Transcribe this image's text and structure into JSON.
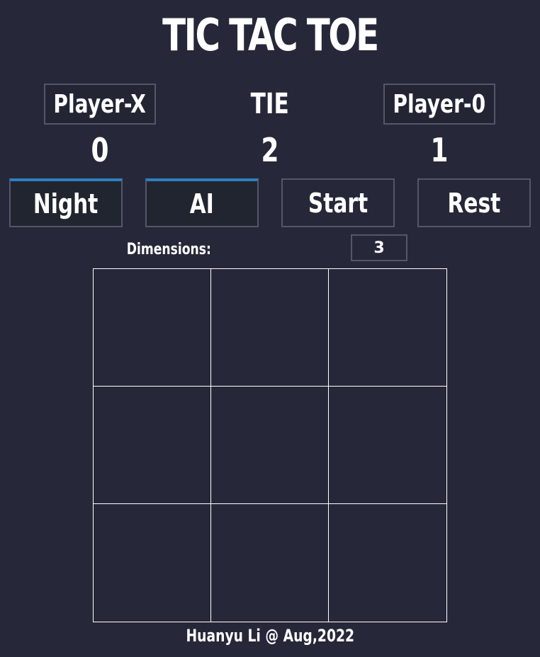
{
  "title": "TIC TAC TOE",
  "players": {
    "x_label": "Player-X",
    "tie_label": "TIE",
    "o_label": "Player-0"
  },
  "scores": {
    "x": "0",
    "tie": "2",
    "o": "1"
  },
  "buttons": {
    "night": "Night",
    "ai": "AI",
    "start": "Start",
    "reset": "Rest"
  },
  "dimensions": {
    "label": "Dimensions:",
    "value": "3"
  },
  "board": {
    "cells": [
      "",
      "",
      "",
      "",
      "",
      "",
      "",
      "",
      ""
    ]
  },
  "footer": "Huanyu Li @ Aug,2022",
  "colors": {
    "background": "#262839",
    "border": "#55566a",
    "active_accent": "#2f7fc1",
    "grid_line": "#ffffff"
  }
}
